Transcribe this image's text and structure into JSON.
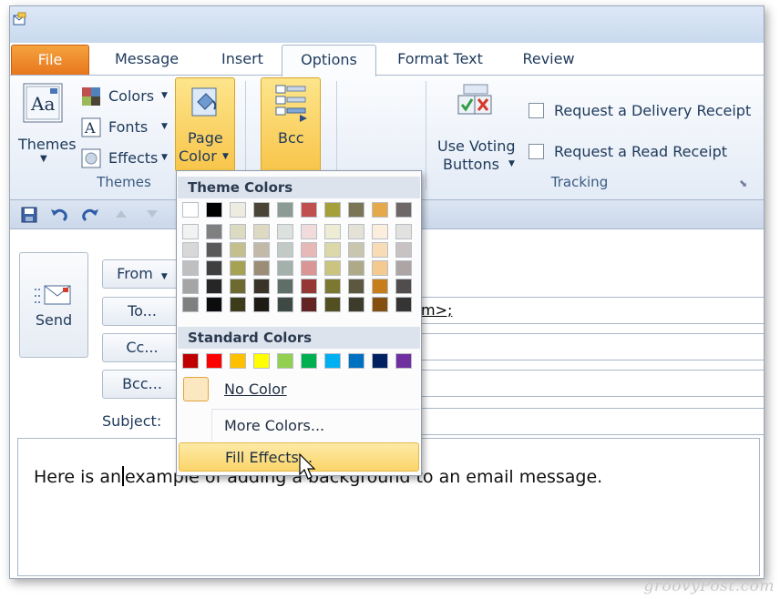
{
  "ribbon_tabs": [
    {
      "label": "File",
      "state": "file"
    },
    {
      "label": "Message",
      "state": ""
    },
    {
      "label": "Insert",
      "state": ""
    },
    {
      "label": "Options",
      "state": "active"
    },
    {
      "label": "Format Text",
      "state": ""
    },
    {
      "label": "Review",
      "state": ""
    }
  ],
  "themes_group": {
    "themes_label": "Themes",
    "colors_label": "Colors",
    "fonts_label": "Fonts",
    "effects_label": "Effects",
    "page_color_line1": "Page",
    "page_color_line2": "Color",
    "group_label": "Themes"
  },
  "show_fields_group": {
    "bcc_label": "Bcc"
  },
  "tracking_group": {
    "voting_line1": "Use Voting",
    "voting_line2": "Buttons",
    "delivery_receipt": "Request a Delivery Receipt",
    "read_receipt": "Request a Read Receipt",
    "group_label": "Tracking"
  },
  "compose": {
    "send_label": "Send",
    "from_label": "From",
    "to_label": "To...",
    "cc_label": "Cc...",
    "bcc_label": "Bcc...",
    "subject_label": "Subject:",
    "to_value": "m>;",
    "body_before_cursor": "Here is an",
    "body_after_cursor": "example of adding a background to an email message."
  },
  "page_color_menu": {
    "theme_colors_heading": "Theme Colors",
    "standard_colors_heading": "Standard Colors",
    "no_color": "No Color",
    "more_colors": "More Colors...",
    "fill_effects": "Fill Effects...",
    "theme_colors": [
      [
        "#ffffff",
        "#000000",
        "#eeece1",
        "#4a4436",
        "#8c9c94",
        "#c0504d",
        "#a6a03c",
        "#7a7555",
        "#e5a84a",
        "#6d6767"
      ],
      [
        "#f2f2f2",
        "#7f7f7f",
        "#dddac2",
        "#ddd9c3",
        "#dde1de",
        "#f2dcdb",
        "#eeecd4",
        "#e4e2d7",
        "#fbeedc",
        "#e3e0e0"
      ],
      [
        "#d8d8d8",
        "#595959",
        "#c4c08d",
        "#c3b9a8",
        "#c2cac6",
        "#e6b9b8",
        "#dcd8aa",
        "#c9c6b0",
        "#f8dcb5",
        "#c8c2c2"
      ],
      [
        "#bfbfbf",
        "#3f3f3f",
        "#a6a254",
        "#9c8d76",
        "#a4b1aa",
        "#da9694",
        "#cbc480",
        "#aeaa88",
        "#f5ca91",
        "#ada4a4"
      ],
      [
        "#a5a5a5",
        "#262626",
        "#6c6a2f",
        "#3a3428",
        "#5f6e66",
        "#953734",
        "#7c7830",
        "#5c583f",
        "#c87d1b",
        "#524d4d"
      ],
      [
        "#7f7f7f",
        "#0c0c0c",
        "#3c3b1a",
        "#1e1b15",
        "#3f4944",
        "#632423",
        "#524f20",
        "#3d3b2a",
        "#854f0f",
        "#363333"
      ]
    ],
    "standard_colors": [
      "#c00000",
      "#ff0000",
      "#ffc000",
      "#ffff00",
      "#92d050",
      "#00b050",
      "#00b0f0",
      "#0070c0",
      "#002060",
      "#7030a0"
    ]
  },
  "watermark": "groovyPost.com",
  "accent_colors": {
    "file_tab": "#e7751d",
    "highlight": "#f8c54a"
  }
}
